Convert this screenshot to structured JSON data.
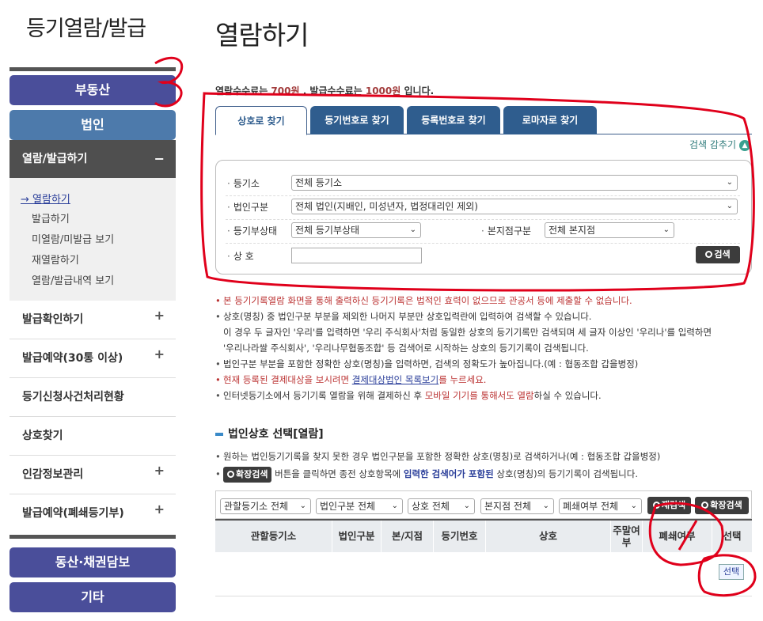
{
  "sidebar": {
    "title": "등기열람/발급",
    "realestate_label": "부동산",
    "corp_label": "법인",
    "active_sub": "열람/발급하기",
    "sub_links": [
      "열람하기",
      "발급하기",
      "미열람/미발급 보기",
      "재열람하기",
      "열람/발급내역 보기"
    ],
    "menu": [
      "발급확인하기",
      "발급예약(30통 이상)",
      "등기신청사건처리현황",
      "상호찾기",
      "인감정보관리",
      "발급예약(폐쇄등기부)"
    ],
    "movable_label": "동산·채권담보",
    "etc_label": "기타"
  },
  "main": {
    "page_title": "열람하기",
    "fee": {
      "p1": "열람수수료는 ",
      "v1": "700원",
      "p2": " , 발급수수료는 ",
      "v2": "1000원",
      "p3": " 입니다."
    },
    "tabs": [
      "상호로 찾기",
      "등기번호로 찾기",
      "등록번호로 찾기",
      "로마자로 찾기"
    ],
    "collapse_label": "검색 감추기",
    "form": {
      "registry_label": "등기소",
      "registry_value": "전체 등기소",
      "corp_type_label": "법인구분",
      "corp_type_value": "전체 법인(지배인, 미성년자, 법정대리인 제외)",
      "status_label": "등기부상태",
      "status_value": "전체 등기부상태",
      "branch_label": "본지점구분",
      "branch_value": "전체 본지점",
      "name_label": "상 호",
      "search_button": "검색"
    },
    "notes": [
      "본 등기기록열람 화면을 통해 출력하신 등기기록은 법적인 효력이 없으므로 관공서 등에 제출할 수 없습니다.",
      "상호(명칭) 중 법인구분 부분을 제외한 나머지 부분만 상호입력란에 입력하여 검색할 수 있습니다.",
      "이 경우 두 글자인 '우리'를 입력하면 '우리 주식회사'처럼 동일한 상호의 등기기록만 검색되며 세 글자 이상인 '우리나'를 입력하면",
      "'우리나라쌀 주식회사', '우리나무협동조합' 등 검색어로 시작하는 상호의 등기기록이 검색됩니다.",
      "법인구분 부분을 포함한 정확한 상호(명칭)을 입력하면, 검색의 정확도가 높아집니다.(예 : 협동조합 갑을병정)",
      "현재 등록된 결제대상을 보시려면 ",
      "결제대상법인 목록보기",
      "를 누르세요.",
      "인터넷등기소에서 등기기록 열람을 위해 결제하신 후 ",
      "모바일 기기를 통해서도 열람",
      "하실 수 있습니다."
    ],
    "section_title": "법인상호 선택[열람]",
    "section_notes": {
      "n1": "원하는 법인등기기록을 찾지 못한 경우 법인구분을 포함한 정확한 상호(명칭)로 검색하거나(예 : 협동조합 갑을병정)",
      "btn": "확장검색",
      "n2a": " 버튼을 클릭하면 종전 상호항목에 ",
      "n2b": "입력한 검색어가 포함된",
      "n2c": " 상호(명칭)의 등기기록이 검색됩니다."
    },
    "filters": [
      "관할등기소 전체",
      "법인구분 전체",
      "상호 전체",
      "본지점 전체",
      "폐쇄여부 전체"
    ],
    "filter_buttons": [
      "재검색",
      "확장검색"
    ],
    "table_headers": [
      "관할등기소",
      "법인구분",
      "본/지점",
      "등기번호",
      "상호",
      "주말여부",
      "폐쇄여부",
      "선택"
    ],
    "row_select": "선택"
  },
  "annotations": {
    "mark_top": "3",
    "mark_table": "1",
    "color": "#e0001b"
  }
}
